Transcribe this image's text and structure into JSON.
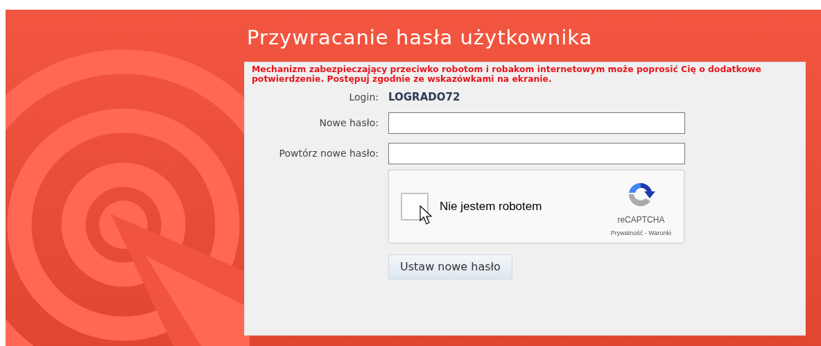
{
  "page": {
    "title": "Przywracanie hasła użytkownika"
  },
  "notice": "Mechanizm zabezpieczający przeciwko robotom i robakom internetowym może poprosić Cię o dodatkowe potwierdzenie. Postępuj zgodnie ze wskazówkami na ekranie.",
  "login": {
    "label": "Login:",
    "value": "LOGRADO72"
  },
  "fields": [
    {
      "label": "Nowe hasło:"
    },
    {
      "label": "Powtórz nowe hasło:"
    }
  ],
  "captcha": {
    "label": "Nie jestem robotem",
    "checked": false,
    "brand": "reCAPTCHA",
    "links": "Prywatność - Warunki"
  },
  "submit_button": "Ustaw nowe hasło"
}
